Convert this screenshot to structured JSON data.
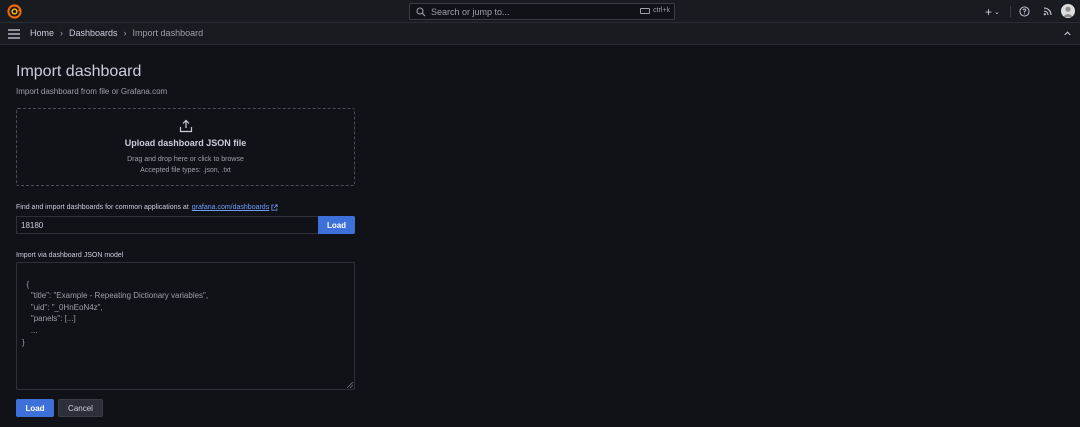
{
  "search": {
    "placeholder": "Search or jump to...",
    "shortcut": "ctrl+k"
  },
  "topbar": {
    "add_label": "+"
  },
  "breadcrumb": [
    "Home",
    "Dashboards",
    "Import dashboard"
  ],
  "page": {
    "title": "Import dashboard",
    "subtitle": "Import dashboard from file or Grafana.com"
  },
  "upload": {
    "title": "Upload dashboard JSON file",
    "hint": "Drag and drop here or click to browse",
    "accepted": "Accepted file types: .json, .txt"
  },
  "grafana_com": {
    "label": "Find and import dashboards for common applications at",
    "link": "grafana.com/dashboards",
    "value": "18180",
    "load_label": "Load"
  },
  "json_model": {
    "label": "Import via dashboard JSON model",
    "placeholder": "{\n    \"title\": \"Example - Repeating Dictionary variables\",\n    \"uid\": \"_0HnEoN4z\",\n    \"panels\": [...]\n    ...\n}"
  },
  "actions": {
    "load": "Load",
    "cancel": "Cancel"
  },
  "colors": {
    "primary": "#3d71d9",
    "background": "#111217",
    "link": "#6e9fff",
    "logo": "#f46800"
  }
}
